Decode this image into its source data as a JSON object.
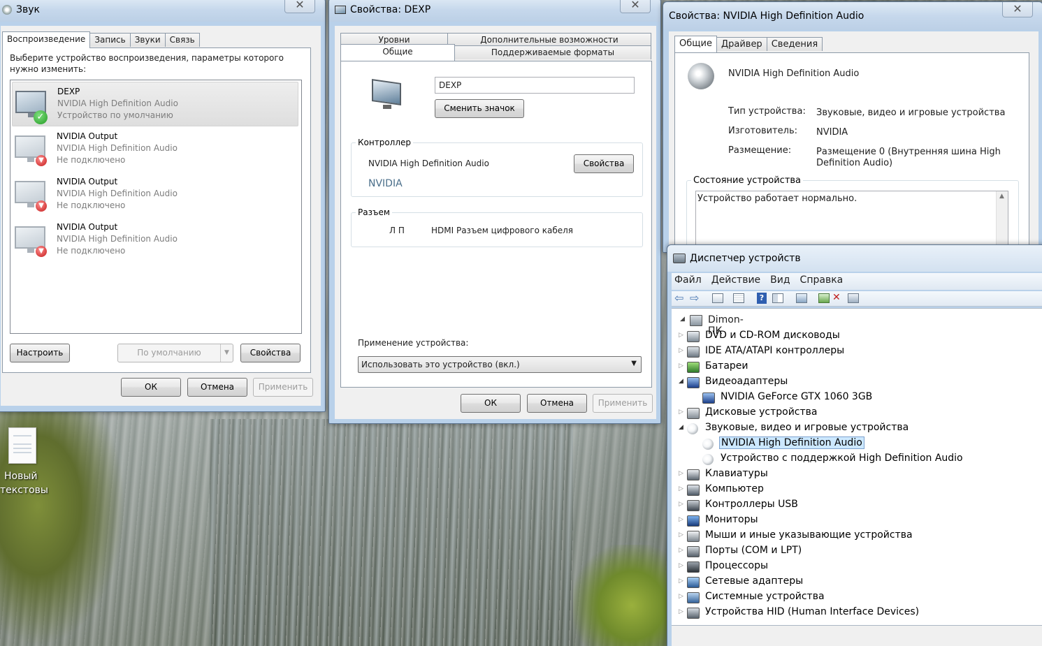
{
  "desktop": {
    "icon_label_line1": "Новый",
    "icon_label_line2": "текстовы..."
  },
  "sound_window": {
    "title": "Звук",
    "tabs": [
      "Воспроизведение",
      "Запись",
      "Звуки",
      "Связь"
    ],
    "instruction": "Выберите устройство воспроизведения, параметры которого нужно изменить:",
    "devices": [
      {
        "name": "DEXP",
        "driver": "NVIDIA High Definition Audio",
        "status": "Устройство по умолчанию",
        "state": "default"
      },
      {
        "name": "NVIDIA Output",
        "driver": "NVIDIA High Definition Audio",
        "status": "Не подключено",
        "state": "disconnected"
      },
      {
        "name": "NVIDIA Output",
        "driver": "NVIDIA High Definition Audio",
        "status": "Не подключено",
        "state": "disconnected"
      },
      {
        "name": "NVIDIA Output",
        "driver": "NVIDIA High Definition Audio",
        "status": "Не подключено",
        "state": "disconnected"
      }
    ],
    "btn_configure": "Настроить",
    "btn_default": "По умолчанию",
    "btn_properties": "Свойства",
    "btn_ok": "ОК",
    "btn_cancel": "Отмена",
    "btn_apply": "Применить"
  },
  "dexp_window": {
    "title": "Свойства: DEXP",
    "tabs_row1": [
      "Уровни",
      "Дополнительные возможности"
    ],
    "tabs_row2": [
      "Общие",
      "Поддерживаемые форматы"
    ],
    "device_name_value": "DEXP",
    "btn_change_icon": "Сменить значок",
    "controller_label": "Контроллер",
    "controller_name": "NVIDIA High Definition Audio",
    "controller_vendor": "NVIDIA",
    "btn_controller_props": "Свойства",
    "jack_label": "Разъем",
    "jack_channels": "Л П",
    "jack_desc": "HDMI Разъем цифрового кабеля",
    "usage_label": "Применение устройства:",
    "usage_value": "Использовать это устройство (вкл.)",
    "btn_ok": "ОК",
    "btn_cancel": "Отмена",
    "btn_apply": "Применить"
  },
  "nvidia_window": {
    "title": "Свойства: NVIDIA High Definition Audio",
    "tabs": [
      "Общие",
      "Драйвер",
      "Сведения"
    ],
    "device_name": "NVIDIA High Definition Audio",
    "type_label": "Тип устройства:",
    "type_value": "Звуковые, видео и игровые устройства",
    "maker_label": "Изготовитель:",
    "maker_value": "NVIDIA",
    "location_label": "Размещение:",
    "location_value_line1": "Размещение 0 (Внутренняя шина High",
    "location_value_line2": "Definition Audio)",
    "status_label": "Состояние устройства",
    "status_text": "Устройство работает нормально."
  },
  "devmgr_window": {
    "title": "Диспетчер устройств",
    "menu": [
      "Файл",
      "Действие",
      "Вид",
      "Справка"
    ],
    "toolbar_icons": [
      "back-icon",
      "forward-icon",
      "show-hide-tree-icon",
      "properties-icon",
      "help-icon",
      "view-icon",
      "scan-hardware-icon",
      "update-driver-icon",
      "uninstall-icon",
      "disable-icon"
    ],
    "root": "Dimon-ПК",
    "tree": [
      {
        "label": "DVD и CD-ROM дисководы",
        "level": 1,
        "expanded": false,
        "icon": "dvd-drive-icon"
      },
      {
        "label": "IDE ATA/ATAPI контроллеры",
        "level": 1,
        "expanded": false,
        "icon": "ide-controller-icon"
      },
      {
        "label": "Батареи",
        "level": 1,
        "expanded": false,
        "icon": "battery-icon"
      },
      {
        "label": "Видеоадаптеры",
        "level": 1,
        "expanded": true,
        "icon": "display-adapter-icon"
      },
      {
        "label": "NVIDIA GeForce GTX 1060 3GB",
        "level": 2,
        "icon": "display-adapter-icon"
      },
      {
        "label": "Дисковые устройства",
        "level": 1,
        "expanded": false,
        "icon": "disk-drive-icon"
      },
      {
        "label": "Звуковые, видео и игровые устройства",
        "level": 1,
        "expanded": true,
        "icon": "speaker-icon"
      },
      {
        "label": "NVIDIA High Definition Audio",
        "level": 2,
        "selected": true,
        "icon": "speaker-icon"
      },
      {
        "label": "Устройство с поддержкой High Definition Audio",
        "level": 2,
        "icon": "speaker-icon"
      },
      {
        "label": "Клавиатуры",
        "level": 1,
        "expanded": false,
        "icon": "keyboard-icon"
      },
      {
        "label": "Компьютер",
        "level": 1,
        "expanded": false,
        "icon": "computer-icon"
      },
      {
        "label": "Контроллеры USB",
        "level": 1,
        "expanded": false,
        "icon": "usb-icon"
      },
      {
        "label": "Мониторы",
        "level": 1,
        "expanded": false,
        "icon": "monitor-icon"
      },
      {
        "label": "Мыши и иные указывающие устройства",
        "level": 1,
        "expanded": false,
        "icon": "mouse-icon"
      },
      {
        "label": "Порты (COM и LPT)",
        "level": 1,
        "expanded": false,
        "icon": "port-icon"
      },
      {
        "label": "Процессоры",
        "level": 1,
        "expanded": false,
        "icon": "processor-icon"
      },
      {
        "label": "Сетевые адаптеры",
        "level": 1,
        "expanded": false,
        "icon": "network-adapter-icon"
      },
      {
        "label": "Системные устройства",
        "level": 1,
        "expanded": false,
        "icon": "system-device-icon"
      },
      {
        "label": "Устройства HID (Human Interface Devices)",
        "level": 1,
        "expanded": false,
        "icon": "hid-icon"
      }
    ]
  },
  "colors": {
    "selection": "#cce8ff",
    "link_vendor": "#4a6e8a",
    "window_frame": "#b9d1ea"
  }
}
